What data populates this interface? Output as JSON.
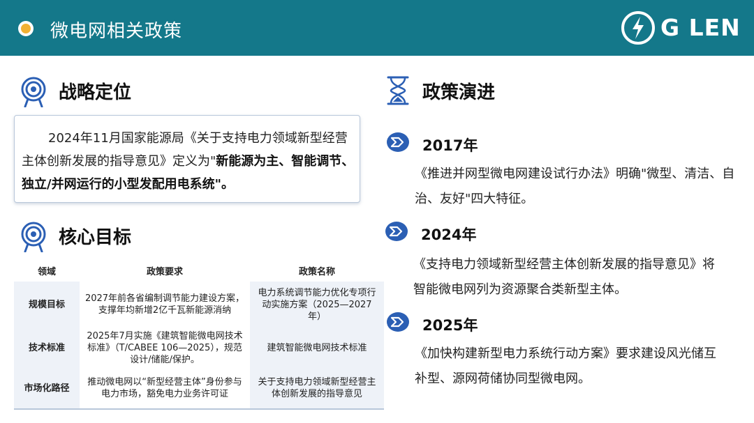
{
  "header": {
    "title": "微电网相关政策",
    "logo_text": "G LEN"
  },
  "strategy": {
    "title": "战略定位",
    "text_plain": "2024年11月国家能源局《关于支持电力领域新型经营主体创新发展的指导意见》定义为\"",
    "text_bold": "新能源为主、智能调节、独立/并网运行的小型发配用电系统",
    "text_end": "\"。"
  },
  "goals": {
    "title": "核心目标",
    "columns": [
      "领域",
      "政策要求",
      "政策名称"
    ],
    "rows": [
      {
        "domain": "规模目标",
        "requirement": "2027年前各省编制调节能力建设方案，支撑年均新增2亿千瓦新能源消纳",
        "policy": "电力系统调节能力优化专项行动实施方案（2025—2027 年）"
      },
      {
        "domain": "技术标准",
        "requirement": "2025年7月实施《建筑智能微电网技术标准》（T/CABEE 106—2025），规范设计/储能/保护。",
        "policy": "建筑智能微电网技术标准"
      },
      {
        "domain": "市场化路径",
        "requirement": "推动微电网以“新型经营主体”身份参与电力市场，豁免电力业务许可证",
        "policy": "关于支持电力领域新型经营主体创新发展的指导意见"
      }
    ]
  },
  "evolution": {
    "title": "政策演进",
    "items": [
      {
        "year": "2017年",
        "text": "《推进并网型微电网建设试行办法》明确\"微型、清洁、自治、友好\"四大特征。"
      },
      {
        "year": "2024年",
        "text": "《支持电力领域新型经营主体创新发展的指导意见》将智能微电网列为资源聚合类新型主体。"
      },
      {
        "year": "2025年",
        "text": "《加快构建新型电力系统行动方案》要求建设风光储互补型、源网荷储协同型微电网。"
      }
    ]
  },
  "colors": {
    "header": "#14788a",
    "accent": "#2b5fb4",
    "dot": "#f2b134"
  }
}
